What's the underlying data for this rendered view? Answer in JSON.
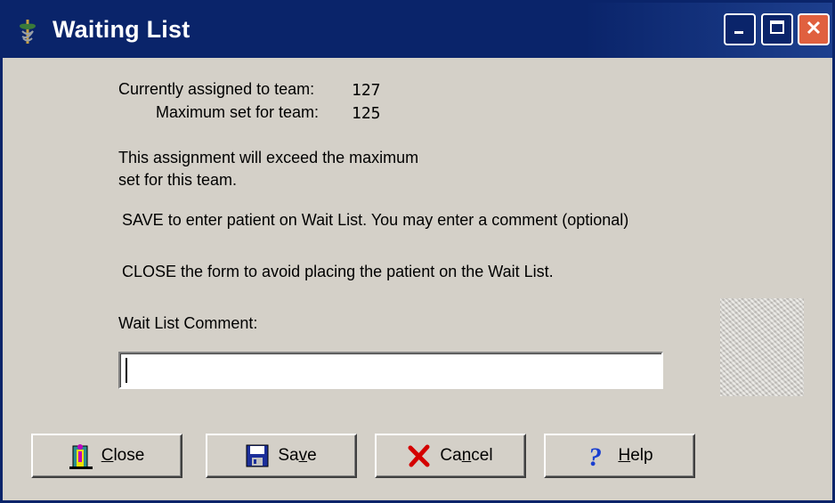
{
  "window": {
    "title": "Waiting List",
    "icon": "caduceus-icon",
    "controls": [
      "minimize-icon",
      "maximize-icon",
      "close-icon"
    ]
  },
  "info": {
    "assigned_label": "Currently assigned to team:",
    "assigned_value": "127",
    "maximum_label": "Maximum set for team:",
    "maximum_value": "125"
  },
  "messages": {
    "exceed_line1": "This assignment will exceed the maximum",
    "exceed_line2": "set for this team.",
    "save_instruction": "SAVE to enter patient on Wait List. You may enter a comment (optional)",
    "close_instruction": "CLOSE the form to avoid placing the patient on the Wait List."
  },
  "comment": {
    "label": "Wait List Comment:",
    "value": ""
  },
  "buttons": {
    "close": {
      "label_pre": "",
      "label_mnemonic": "C",
      "label_post": "lose",
      "icon": "door-exit-icon"
    },
    "save": {
      "label_pre": "Sa",
      "label_mnemonic": "v",
      "label_post": "e",
      "icon": "floppy-disk-icon"
    },
    "cancel": {
      "label_pre": "Ca",
      "label_mnemonic": "n",
      "label_post": "cel",
      "icon": "red-x-icon"
    },
    "help": {
      "label_pre": "",
      "label_mnemonic": "H",
      "label_post": "elp",
      "icon": "question-mark-icon"
    }
  },
  "colors": {
    "titlebar": "#0a246a",
    "face": "#d4d0c8",
    "close_button": "#e0603f",
    "cancel_x": "#d40000",
    "help_q": "#1a3fd0"
  }
}
